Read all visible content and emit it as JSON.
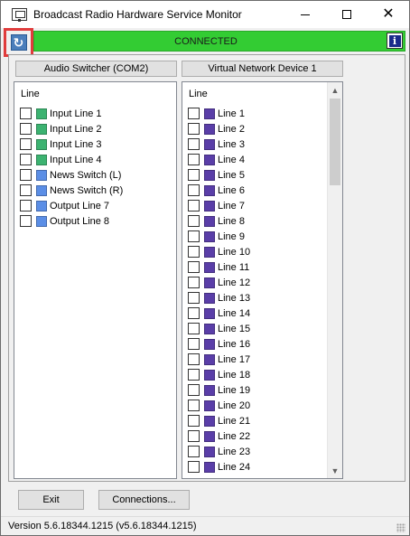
{
  "window": {
    "title": "Broadcast Radio Hardware Service Monitor",
    "min_symbol": "",
    "close_symbol": "✕"
  },
  "status": {
    "text": "CONNECTED",
    "color": "#33cc33",
    "refresh_icon": "↻",
    "info_icon": "i"
  },
  "left_panel": {
    "header": "Audio Switcher (COM2)",
    "column_label": "Line",
    "items": [
      {
        "label": "Input Line 1",
        "color": "#3cb371"
      },
      {
        "label": "Input Line 2",
        "color": "#3cb371"
      },
      {
        "label": "Input Line 3",
        "color": "#3cb371"
      },
      {
        "label": "Input Line 4",
        "color": "#3cb371"
      },
      {
        "label": "News Switch (L)",
        "color": "#5b8ee6"
      },
      {
        "label": "News Switch (R)",
        "color": "#5b8ee6"
      },
      {
        "label": "Output Line 7",
        "color": "#5b8ee6"
      },
      {
        "label": "Output Line 8",
        "color": "#5b8ee6"
      }
    ]
  },
  "right_panel": {
    "header": "Virtual Network Device 1",
    "column_label": "Line",
    "swatch_color": "#5a3ea8",
    "items": [
      "Line 1",
      "Line 2",
      "Line 3",
      "Line 4",
      "Line 5",
      "Line 6",
      "Line 7",
      "Line 8",
      "Line 9",
      "Line 10",
      "Line 11",
      "Line 12",
      "Line 13",
      "Line 14",
      "Line 15",
      "Line 16",
      "Line 17",
      "Line 18",
      "Line 19",
      "Line 20",
      "Line 21",
      "Line 22",
      "Line 23",
      "Line 24"
    ]
  },
  "buttons": {
    "exit": "Exit",
    "connections": "Connections..."
  },
  "footer": {
    "version": "Version 5.6.18344.1215 (v5.6.18344.1215)"
  }
}
